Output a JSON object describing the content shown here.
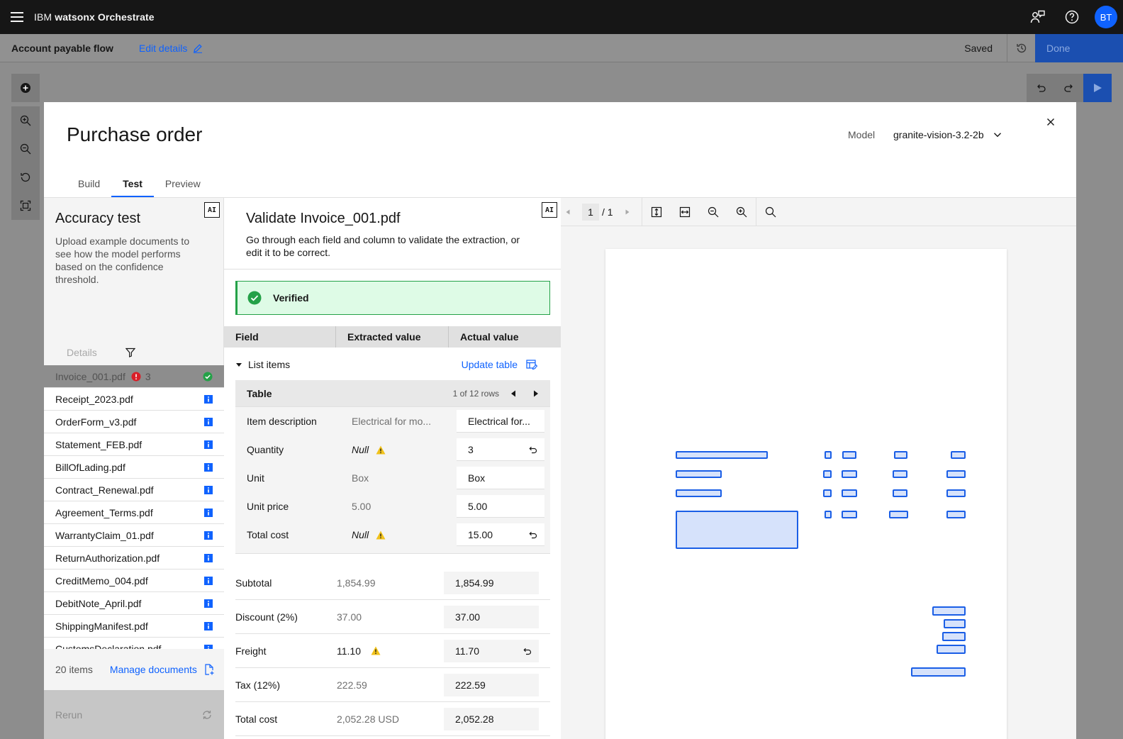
{
  "header": {
    "brand_prefix": "IBM",
    "brand_product": "watsonx Orchestrate",
    "avatar_initials": "BT",
    "menu_icon": "hamburger-menu-icon",
    "icons": [
      "agent-chat-icon",
      "help-icon"
    ]
  },
  "subbar": {
    "flow_title": "Account payable flow",
    "edit_label": "Edit details",
    "saved_label": "Saved",
    "done_label": "Done"
  },
  "modal": {
    "title": "Purchase order",
    "model_label": "Model",
    "model_value": "granite-vision-3.2-2b",
    "tabs": [
      {
        "label": "Build",
        "active": false
      },
      {
        "label": "Test",
        "active": true
      },
      {
        "label": "Preview",
        "active": false
      }
    ]
  },
  "left": {
    "ai_badge": "AI",
    "title": "Accuracy test",
    "description": "Upload example documents to see how the model performs based on the confidence threshold.",
    "details_label": "Details",
    "documents": [
      {
        "name": "Invoice_001.pdf",
        "errors": "3",
        "selected": true
      },
      {
        "name": "Receipt_2023.pdf"
      },
      {
        "name": "OrderForm_v3.pdf"
      },
      {
        "name": "Statement_FEB.pdf"
      },
      {
        "name": "BillOfLading.pdf"
      },
      {
        "name": "Contract_Renewal.pdf"
      },
      {
        "name": "Agreement_Terms.pdf"
      },
      {
        "name": "WarrantyClaim_01.pdf"
      },
      {
        "name": "ReturnAuthorization.pdf"
      },
      {
        "name": "CreditMemo_004.pdf"
      },
      {
        "name": "DebitNote_April.pdf"
      },
      {
        "name": "ShippingManifest.pdf"
      },
      {
        "name": "CustomsDeclaration.pdf"
      }
    ],
    "item_count": "20 items",
    "manage_label": "Manage documents",
    "rerun_label": "Rerun"
  },
  "middle": {
    "ai_badge": "AI",
    "title": "Validate Invoice_001.pdf",
    "description": "Go through each field and column to validate the extraction, or edit it to be correct.",
    "verified_label": "Verified",
    "columns": [
      "Field",
      "Extracted value",
      "Actual value"
    ],
    "list_items_label": "List items",
    "update_table_label": "Update table",
    "table": {
      "name": "Table",
      "rows_label": "1 of 12 rows",
      "rows": [
        {
          "field": "Item description",
          "extracted": "Electrical for mo...",
          "actual": "Electrical for...",
          "warning": false,
          "reverted": false
        },
        {
          "field": "Quantity",
          "extracted": "Null",
          "actual": "3",
          "warning": true,
          "reverted": true
        },
        {
          "field": "Unit",
          "extracted": "Box",
          "actual": "Box",
          "warning": false,
          "reverted": false
        },
        {
          "field": "Unit price",
          "extracted": "5.00",
          "actual": "5.00",
          "warning": false,
          "reverted": false
        },
        {
          "field": "Total cost",
          "extracted": "Null",
          "actual": "15.00",
          "warning": true,
          "reverted": true
        }
      ]
    },
    "summary": [
      {
        "field": "Subtotal",
        "extracted": "1,854.99",
        "actual": "1,854.99",
        "warning": false,
        "reverted": false
      },
      {
        "field": "Discount (2%)",
        "extracted": "37.00",
        "actual": "37.00",
        "warning": false,
        "reverted": false
      },
      {
        "field": "Freight",
        "extracted": "11.10",
        "actual": "11.70",
        "warning": true,
        "reverted": true
      },
      {
        "field": "Tax (12%)",
        "extracted": "222.59",
        "actual": "222.59",
        "warning": false,
        "reverted": false
      },
      {
        "field": "Total cost",
        "extracted": "2,052.28 USD",
        "actual": "2,052.28",
        "warning": false,
        "reverted": false
      }
    ]
  },
  "viewer": {
    "page_current": "1",
    "page_total": "/ 1"
  },
  "colors": {
    "primary": "#0f62fe",
    "success": "#24a148",
    "error": "#da1e28",
    "warning": "#f1c21b",
    "highlight": "#1a5ee6"
  }
}
